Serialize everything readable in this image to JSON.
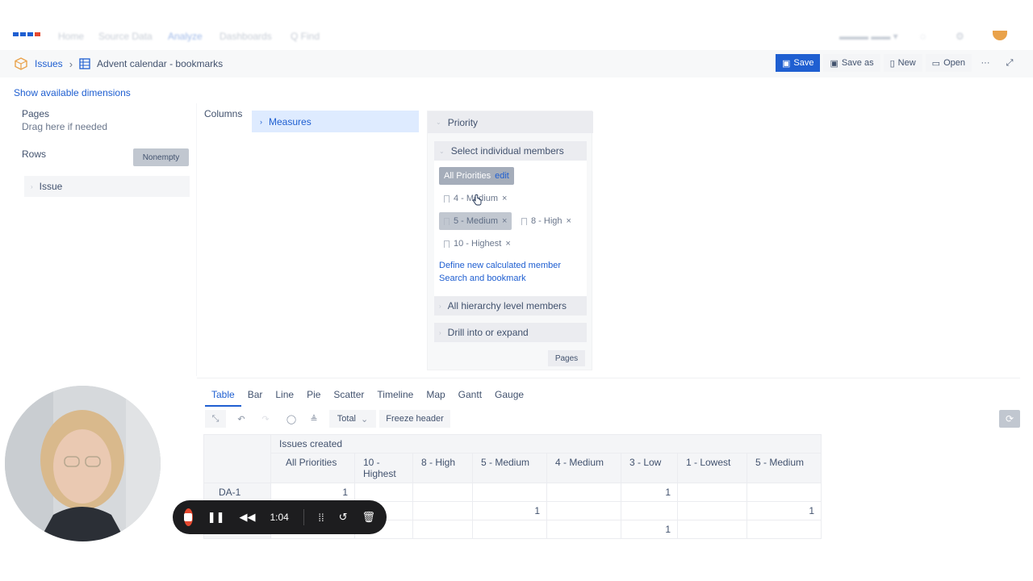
{
  "brand_colors": {
    "primary": "#1f5fd1",
    "selected_chip": "#c1c7d0",
    "measures_chip": "#deebff",
    "record": "#e5482f"
  },
  "nav": {
    "items": [
      "Home",
      "Source Data",
      "Analyze",
      "Dashboards",
      "Q Find"
    ],
    "active_index": 2
  },
  "breadcrumb": {
    "root": "Issues",
    "report_title": "Advent calendar - bookmarks"
  },
  "toolbar": {
    "save": "Save",
    "save_as": "Save as",
    "new": "New",
    "open": "Open",
    "more": "···"
  },
  "layout_panel": {
    "show_dims": "Show available dimensions",
    "pages_label": "Pages",
    "pages_hint": "Drag here if needed",
    "rows_label": "Rows",
    "nonempty": "Nonempty",
    "row_dimension": "Issue",
    "columns_label": "Columns",
    "column_dimension": "Measures"
  },
  "priority_panel": {
    "title": "Priority",
    "select_members": "Select individual members",
    "all_priorities": "All Priorities",
    "edit": "edit",
    "members": [
      {
        "label": "4 - Medium",
        "selected": false
      },
      {
        "label": "5 - Medium",
        "selected": true
      },
      {
        "label": "8 - High",
        "selected": false
      },
      {
        "label": "10 - Highest",
        "selected": false
      }
    ],
    "define_calc": "Define new calculated member",
    "search_bookmark": "Search and bookmark",
    "all_hierarchy": "All hierarchy level members",
    "drill": "Drill into or expand",
    "pages_btn": "Pages"
  },
  "view_tabs": [
    "Table",
    "Bar",
    "Line",
    "Pie",
    "Scatter",
    "Timeline",
    "Map",
    "Gantt",
    "Gauge"
  ],
  "view_tabs_active": 0,
  "table_toolbar": {
    "total": "Total",
    "freeze": "Freeze header"
  },
  "table": {
    "measure_header": "Issues created",
    "columns": [
      "All Priorities",
      "10 - Highest",
      "8 - High",
      "5 - Medium",
      "4 - Medium",
      "3 - Low",
      "1 - Lowest",
      "5 - Medium"
    ],
    "rows": [
      {
        "label": "DA-1",
        "values": [
          "1",
          "",
          "",
          "",
          "",
          "1",
          "",
          ""
        ]
      },
      {
        "label": "",
        "values": [
          "",
          "",
          "",
          "1",
          "",
          "",
          "",
          "1"
        ]
      },
      {
        "label": "",
        "values": [
          "",
          "",
          "",
          "",
          "",
          "1",
          "",
          ""
        ]
      }
    ]
  },
  "recorder": {
    "time": "1:04"
  }
}
